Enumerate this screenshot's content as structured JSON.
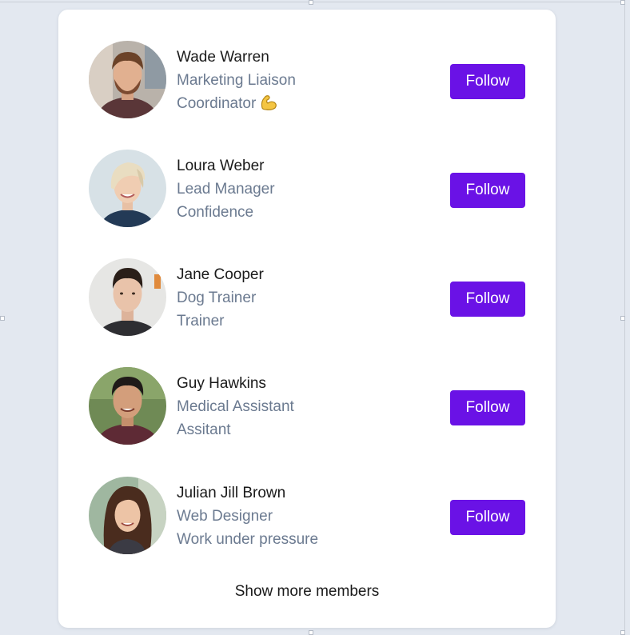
{
  "members": [
    {
      "name": "Wade Warren",
      "role": "Marketing Liaison",
      "tag": "Coordinator",
      "tag_emoji": "flexed-biceps-icon",
      "follow_label": "Follow"
    },
    {
      "name": "Loura Weber",
      "role": "Lead Manager",
      "tag": "Confidence",
      "follow_label": "Follow"
    },
    {
      "name": "Jane Cooper",
      "role": "Dog Trainer",
      "tag": "Trainer",
      "follow_label": "Follow"
    },
    {
      "name": "Guy Hawkins",
      "role": "Medical Assistant",
      "tag": "Assitant",
      "follow_label": "Follow"
    },
    {
      "name": "Julian Jill Brown",
      "role": "Web Designer",
      "tag": "Work under pressure",
      "follow_label": "Follow"
    }
  ],
  "show_more_label": "Show more members",
  "colors": {
    "accent": "#6a12e6",
    "page_background": "#e3e8f0",
    "card_background": "#ffffff",
    "name_text": "#1a1a1a",
    "secondary_text": "#6b7a90"
  }
}
